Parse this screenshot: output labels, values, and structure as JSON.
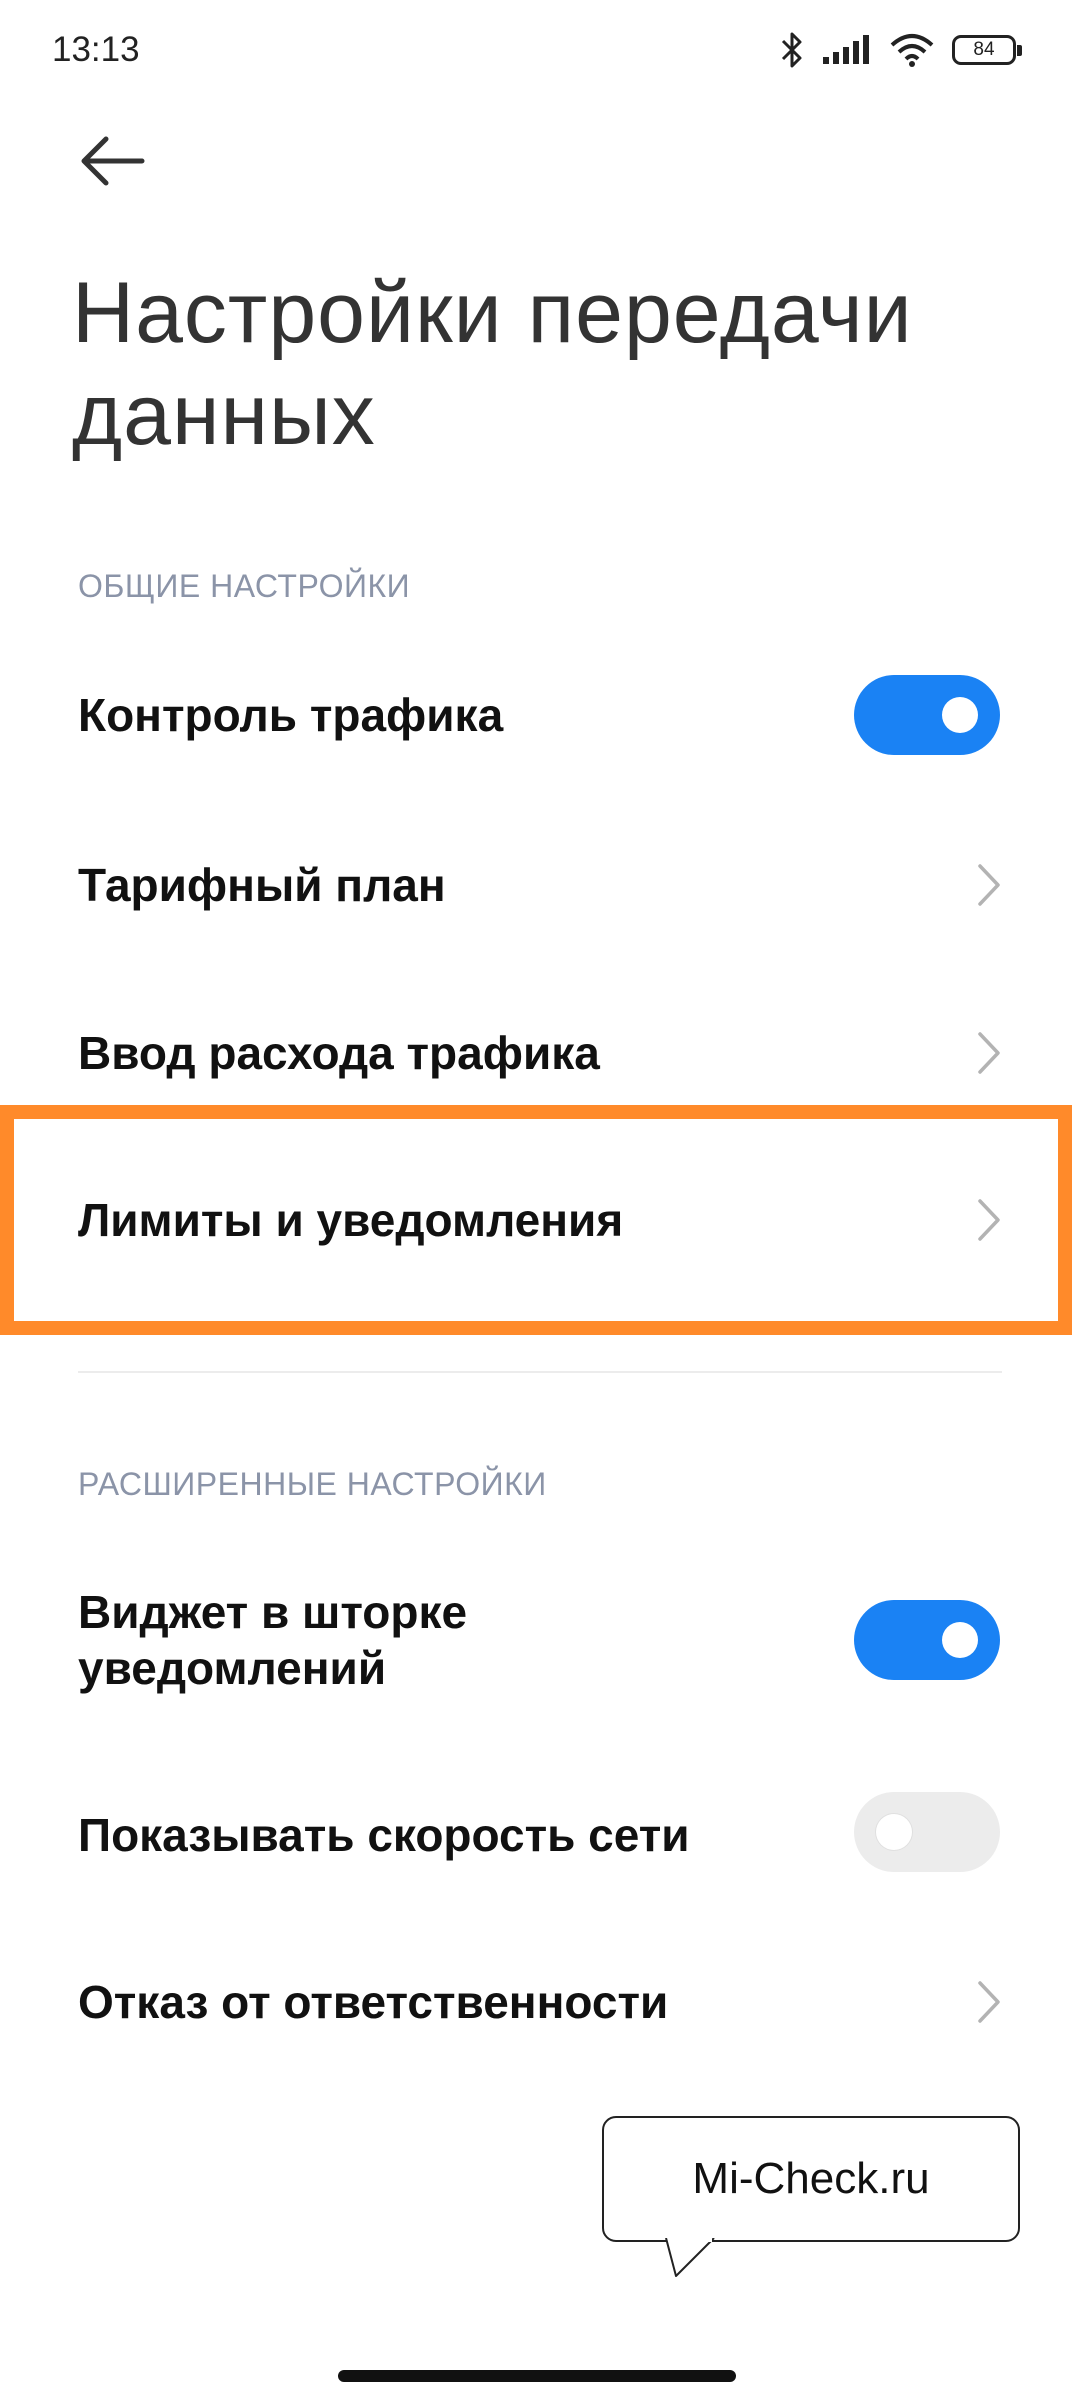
{
  "status_bar": {
    "time": "13:13",
    "battery": "84",
    "icons": [
      "bluetooth-icon",
      "signal-icon",
      "wifi-icon",
      "battery-icon"
    ]
  },
  "header": {
    "back_icon": "arrow-left-icon",
    "title": "Настройки передачи данных"
  },
  "sections": {
    "general": {
      "header": "ОБЩИЕ НАСТРОЙКИ",
      "traffic_control": {
        "label": "Контроль трафика",
        "enabled": true
      },
      "tariff_plan": {
        "label": "Тарифный план"
      },
      "traffic_input": {
        "label": "Ввод расхода трафика"
      },
      "limits": {
        "label": "Лимиты и уведомления",
        "highlighted": true
      }
    },
    "advanced": {
      "header": "РАСШИРЕННЫЕ НАСТРОЙКИ",
      "widget_line1": "Виджет в шторке",
      "widget_line2": "уведомлений",
      "widget_enabled": true,
      "network_speed": {
        "label": "Показывать скорость сети",
        "enabled": false
      },
      "disclaimer": {
        "label": "Отказ от ответственности"
      }
    }
  },
  "watermark": {
    "text": "Mi-Check.ru"
  },
  "colors": {
    "accent": "#1a82f4",
    "highlight": "#ff8a2a",
    "section_header": "#8b94a8",
    "toggle_off": "#ececec"
  }
}
